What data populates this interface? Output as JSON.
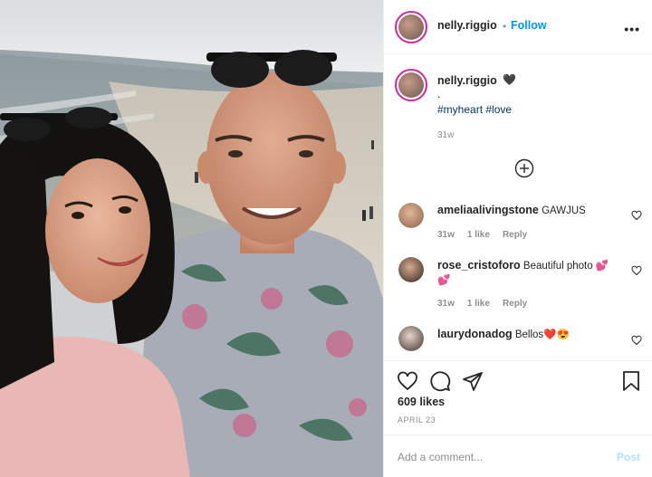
{
  "post": {
    "header": {
      "username": "nelly.riggio",
      "separator": "•",
      "follow_label": "Follow",
      "more_icon": "more-horizontal-icon"
    },
    "caption": {
      "username": "nelly.riggio",
      "emoji": "🖤",
      "dot_line": ".",
      "hashtags": "#myheart #love",
      "time": "31w"
    },
    "add_icon": "plus-circle-icon",
    "comments": [
      {
        "username": "ameliaalivingstone",
        "text": "GAWJUS",
        "time": "31w",
        "likes": "1 like",
        "reply": "Reply"
      },
      {
        "username": "rose_cristoforo",
        "text": "Beautiful photo 💕",
        "text2": "💕",
        "time": "31w",
        "likes": "1 like",
        "reply": "Reply"
      },
      {
        "username": "laurydonadog",
        "text": "Bellos❤️😍"
      }
    ],
    "likes": "609 likes",
    "date": "APRIL 23",
    "comment_placeholder": "Add a comment...",
    "post_label": "Post",
    "colors": {
      "link_blue": "#0095f6",
      "hashtag": "#00376b",
      "post_disabled": "#b2dffc",
      "story_ring": "#d6249f"
    }
  }
}
